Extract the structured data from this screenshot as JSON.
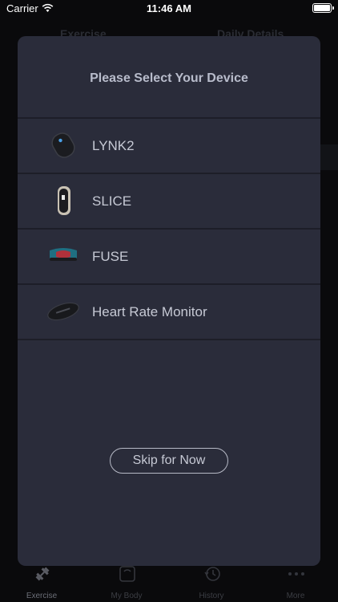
{
  "status_bar": {
    "carrier": "Carrier",
    "time": "11:46 AM"
  },
  "background": {
    "tab_left": "Exercise",
    "tab_right": "Daily Details"
  },
  "modal": {
    "title": "Please Select Your Device",
    "devices": [
      {
        "label": "LYNK2",
        "icon": "lynk2-device-icon"
      },
      {
        "label": "SLICE",
        "icon": "slice-device-icon"
      },
      {
        "label": "FUSE",
        "icon": "fuse-device-icon"
      },
      {
        "label": "Heart Rate Monitor",
        "icon": "heart-rate-monitor-icon"
      }
    ],
    "skip_label": "Skip for Now"
  },
  "tab_bar": {
    "items": [
      {
        "label": "Exercise",
        "icon": "dumbbell-icon",
        "active": true
      },
      {
        "label": "My Body",
        "icon": "scale-icon",
        "active": false
      },
      {
        "label": "History",
        "icon": "history-clock-icon",
        "active": false
      },
      {
        "label": "More",
        "icon": "more-dots-icon",
        "active": false
      }
    ]
  }
}
